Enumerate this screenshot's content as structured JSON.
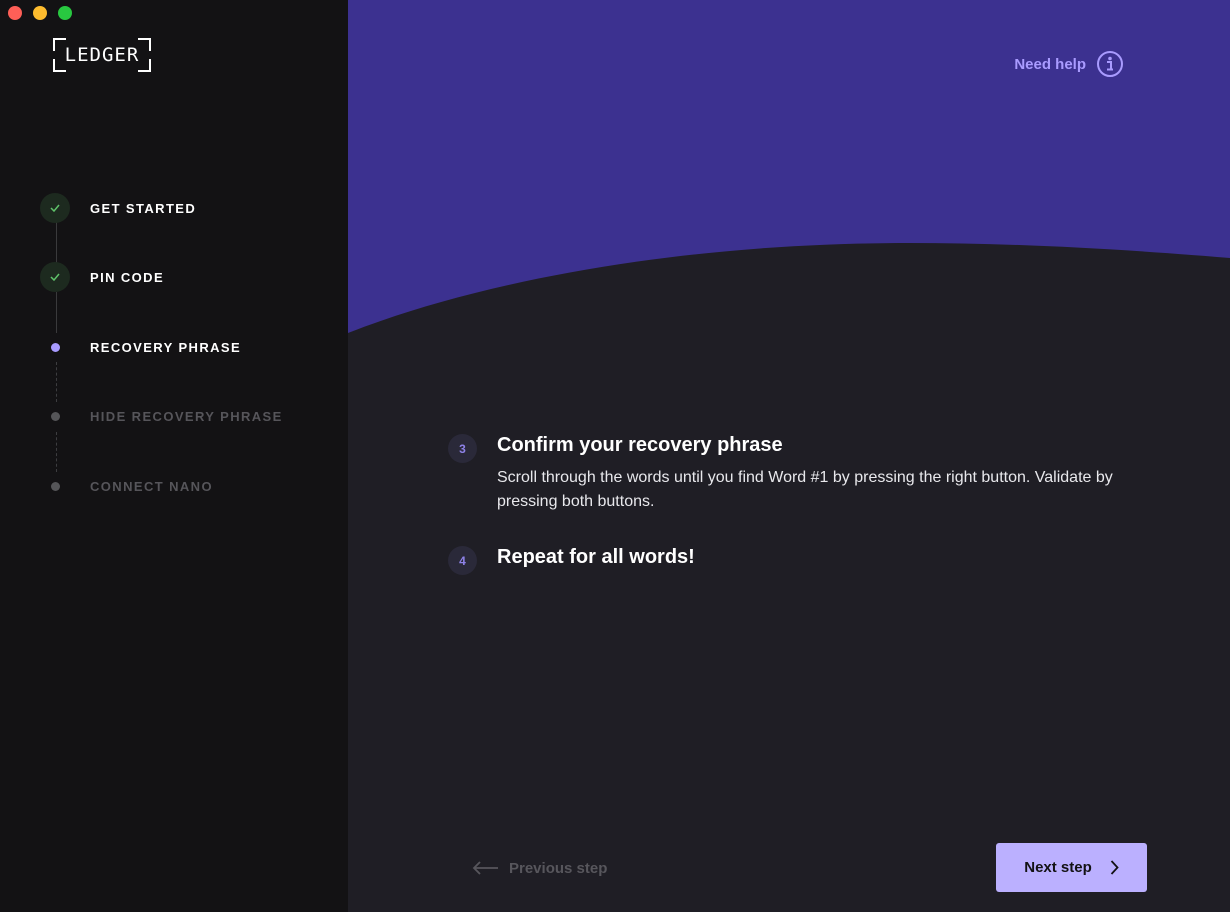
{
  "window": {
    "controls": [
      "close",
      "minimize",
      "maximize"
    ]
  },
  "sidebar": {
    "logo": "LEDGER",
    "steps": [
      {
        "label": "GET STARTED",
        "state": "done",
        "icon": "check-icon"
      },
      {
        "label": "PIN CODE",
        "state": "done",
        "icon": "check-icon"
      },
      {
        "label": "RECOVERY PHRASE",
        "state": "active"
      },
      {
        "label": "HIDE RECOVERY PHRASE",
        "state": "pending"
      },
      {
        "label": "CONNECT NANO",
        "state": "pending"
      }
    ]
  },
  "header": {
    "help_label": "Need help",
    "help_icon": "info-circle-icon"
  },
  "instructions": [
    {
      "number": "3",
      "title": "Confirm your recovery phrase",
      "text": "Scroll through the words until you find Word #1 by pressing the right button. Validate by pressing both buttons."
    },
    {
      "number": "4",
      "title": "Repeat for all words!",
      "text": ""
    }
  ],
  "footer": {
    "previous_label": "Previous step",
    "previous_icon": "arrow-left-icon",
    "next_label": "Next step",
    "next_icon": "chevron-right-icon"
  },
  "colors": {
    "sidebar_bg": "#131214",
    "main_bg": "#1f1e25",
    "header_wave": "#3c3190",
    "accent": "#bbb0ff",
    "success": "#4caf50"
  }
}
